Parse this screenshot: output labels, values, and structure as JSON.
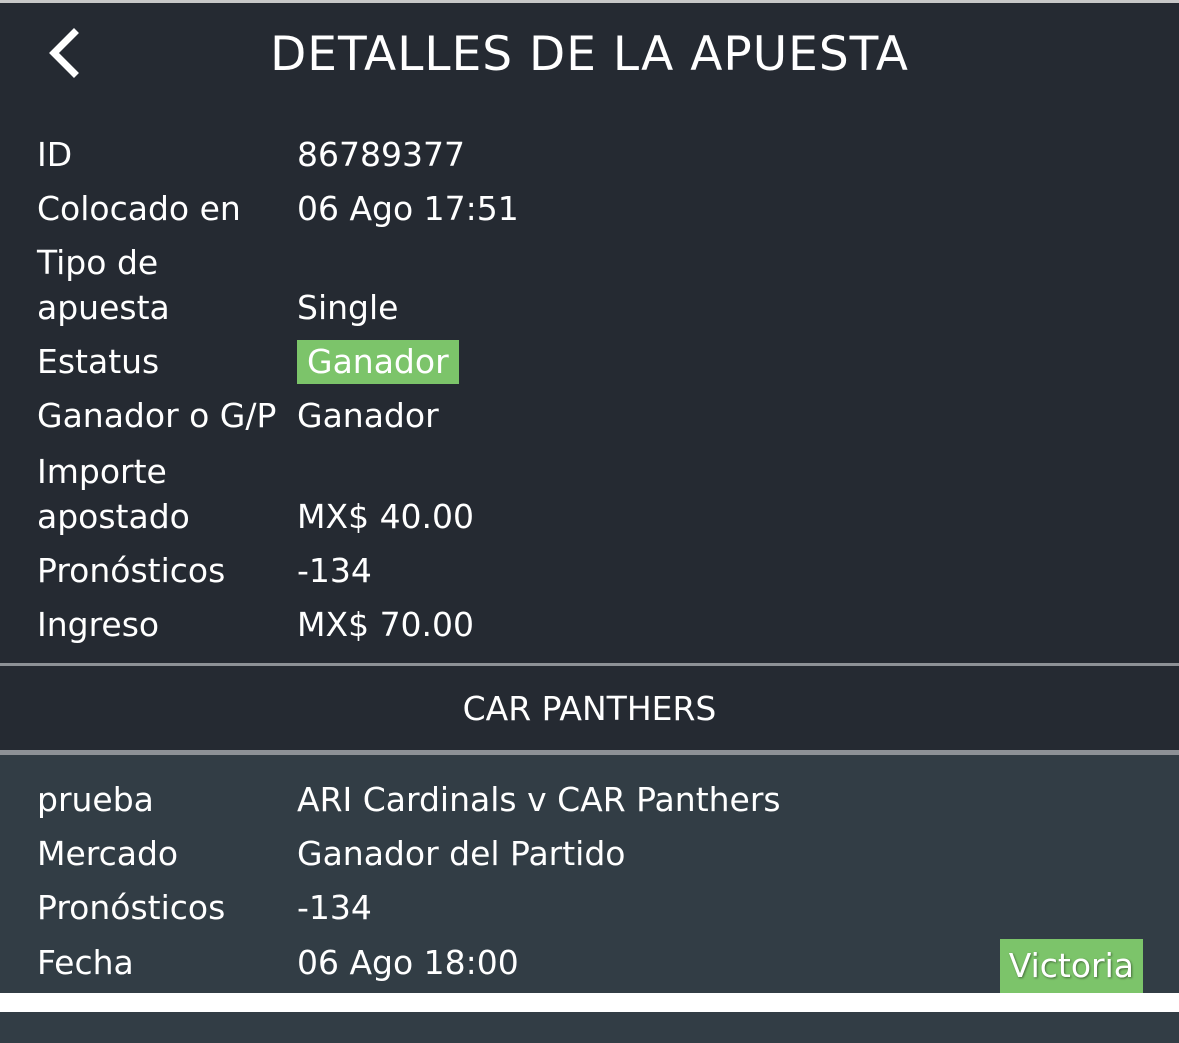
{
  "header": {
    "title": "DETALLES DE LA APUESTA",
    "back_icon": "chevron-left-icon"
  },
  "bet": {
    "id_label": "ID",
    "id_value": "86789377",
    "placed_label": "Colocado en",
    "placed_value": "06 Ago 17:51",
    "type_label_line1": "Tipo de",
    "type_label_line2": "apuesta",
    "type_value": "Single",
    "status_label": "Estatus",
    "status_value": "Ganador",
    "result_label": "Ganador o G/P",
    "result_value": "Ganador",
    "stake_label_line1": "Importe",
    "stake_label_line2": "apostado",
    "stake_value": "MX$ 40.00",
    "odds_label": "Pronósticos",
    "odds_value": "-134",
    "return_label": "Ingreso",
    "return_value": "MX$ 70.00"
  },
  "selection": {
    "heading": "CAR PANTHERS",
    "event_label": "prueba",
    "event_value": "ARI Cardinals v CAR Panthers",
    "market_label": "Mercado",
    "market_value": "Ganador del Partido",
    "odds_label": "Pronósticos",
    "odds_value": "-134",
    "date_label": "Fecha",
    "date_value": "06 Ago 18:00",
    "result_badge": "Victoria"
  },
  "colors": {
    "header_bg": "#252a32",
    "detail_bg": "#323d45",
    "badge_green": "#7cc46a"
  }
}
